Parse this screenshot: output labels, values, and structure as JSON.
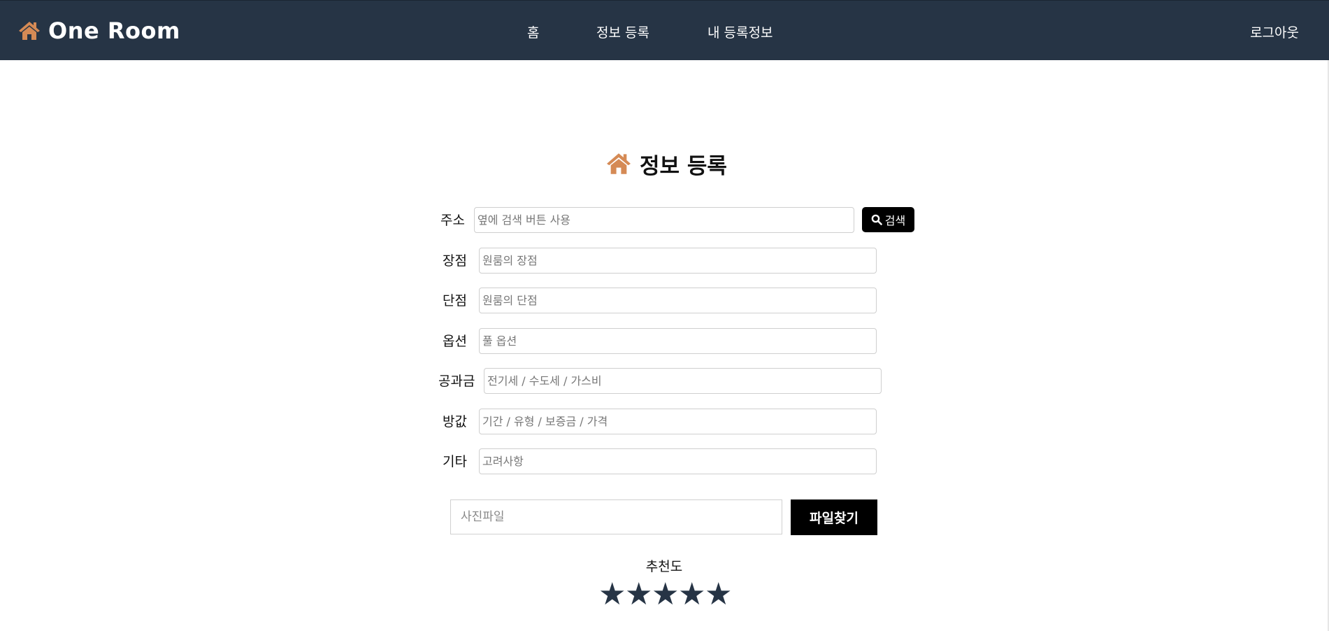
{
  "colors": {
    "navbar_bg": "#263445",
    "accent_icon": "#d58a55",
    "button_bg": "#000000",
    "star": "#263445"
  },
  "header": {
    "brand": "One Room",
    "brand_icon": "home-icon",
    "nav": [
      "홈",
      "정보 등록",
      "내 등록정보"
    ],
    "logout": "로그아웃"
  },
  "form": {
    "title": "정보 등록",
    "title_icon": "home-icon",
    "address": {
      "label": "주소",
      "placeholder": "옆에 검색 버튼 사용"
    },
    "search_button": {
      "label": "검색",
      "icon": "search-icon"
    },
    "pros": {
      "label": "장점",
      "placeholder": "원룸의 장점"
    },
    "cons": {
      "label": "단점",
      "placeholder": "원룸의 단점"
    },
    "options": {
      "label": "옵션",
      "placeholder": "풀 옵션"
    },
    "utilities": {
      "label": "공과금",
      "placeholder": "전기세 / 수도세 / 가스비"
    },
    "rent": {
      "label": "방값",
      "placeholder": "기간 / 유형 / 보증금 / 가격"
    },
    "etc": {
      "label": "기타",
      "placeholder": "고려사항"
    },
    "photo": {
      "placeholder": "사진파일",
      "button_label": "파일찾기"
    },
    "rating": {
      "label": "추천도",
      "stars": [
        "★",
        "★",
        "★",
        "★",
        "★"
      ],
      "value": 5,
      "max": 5
    }
  }
}
